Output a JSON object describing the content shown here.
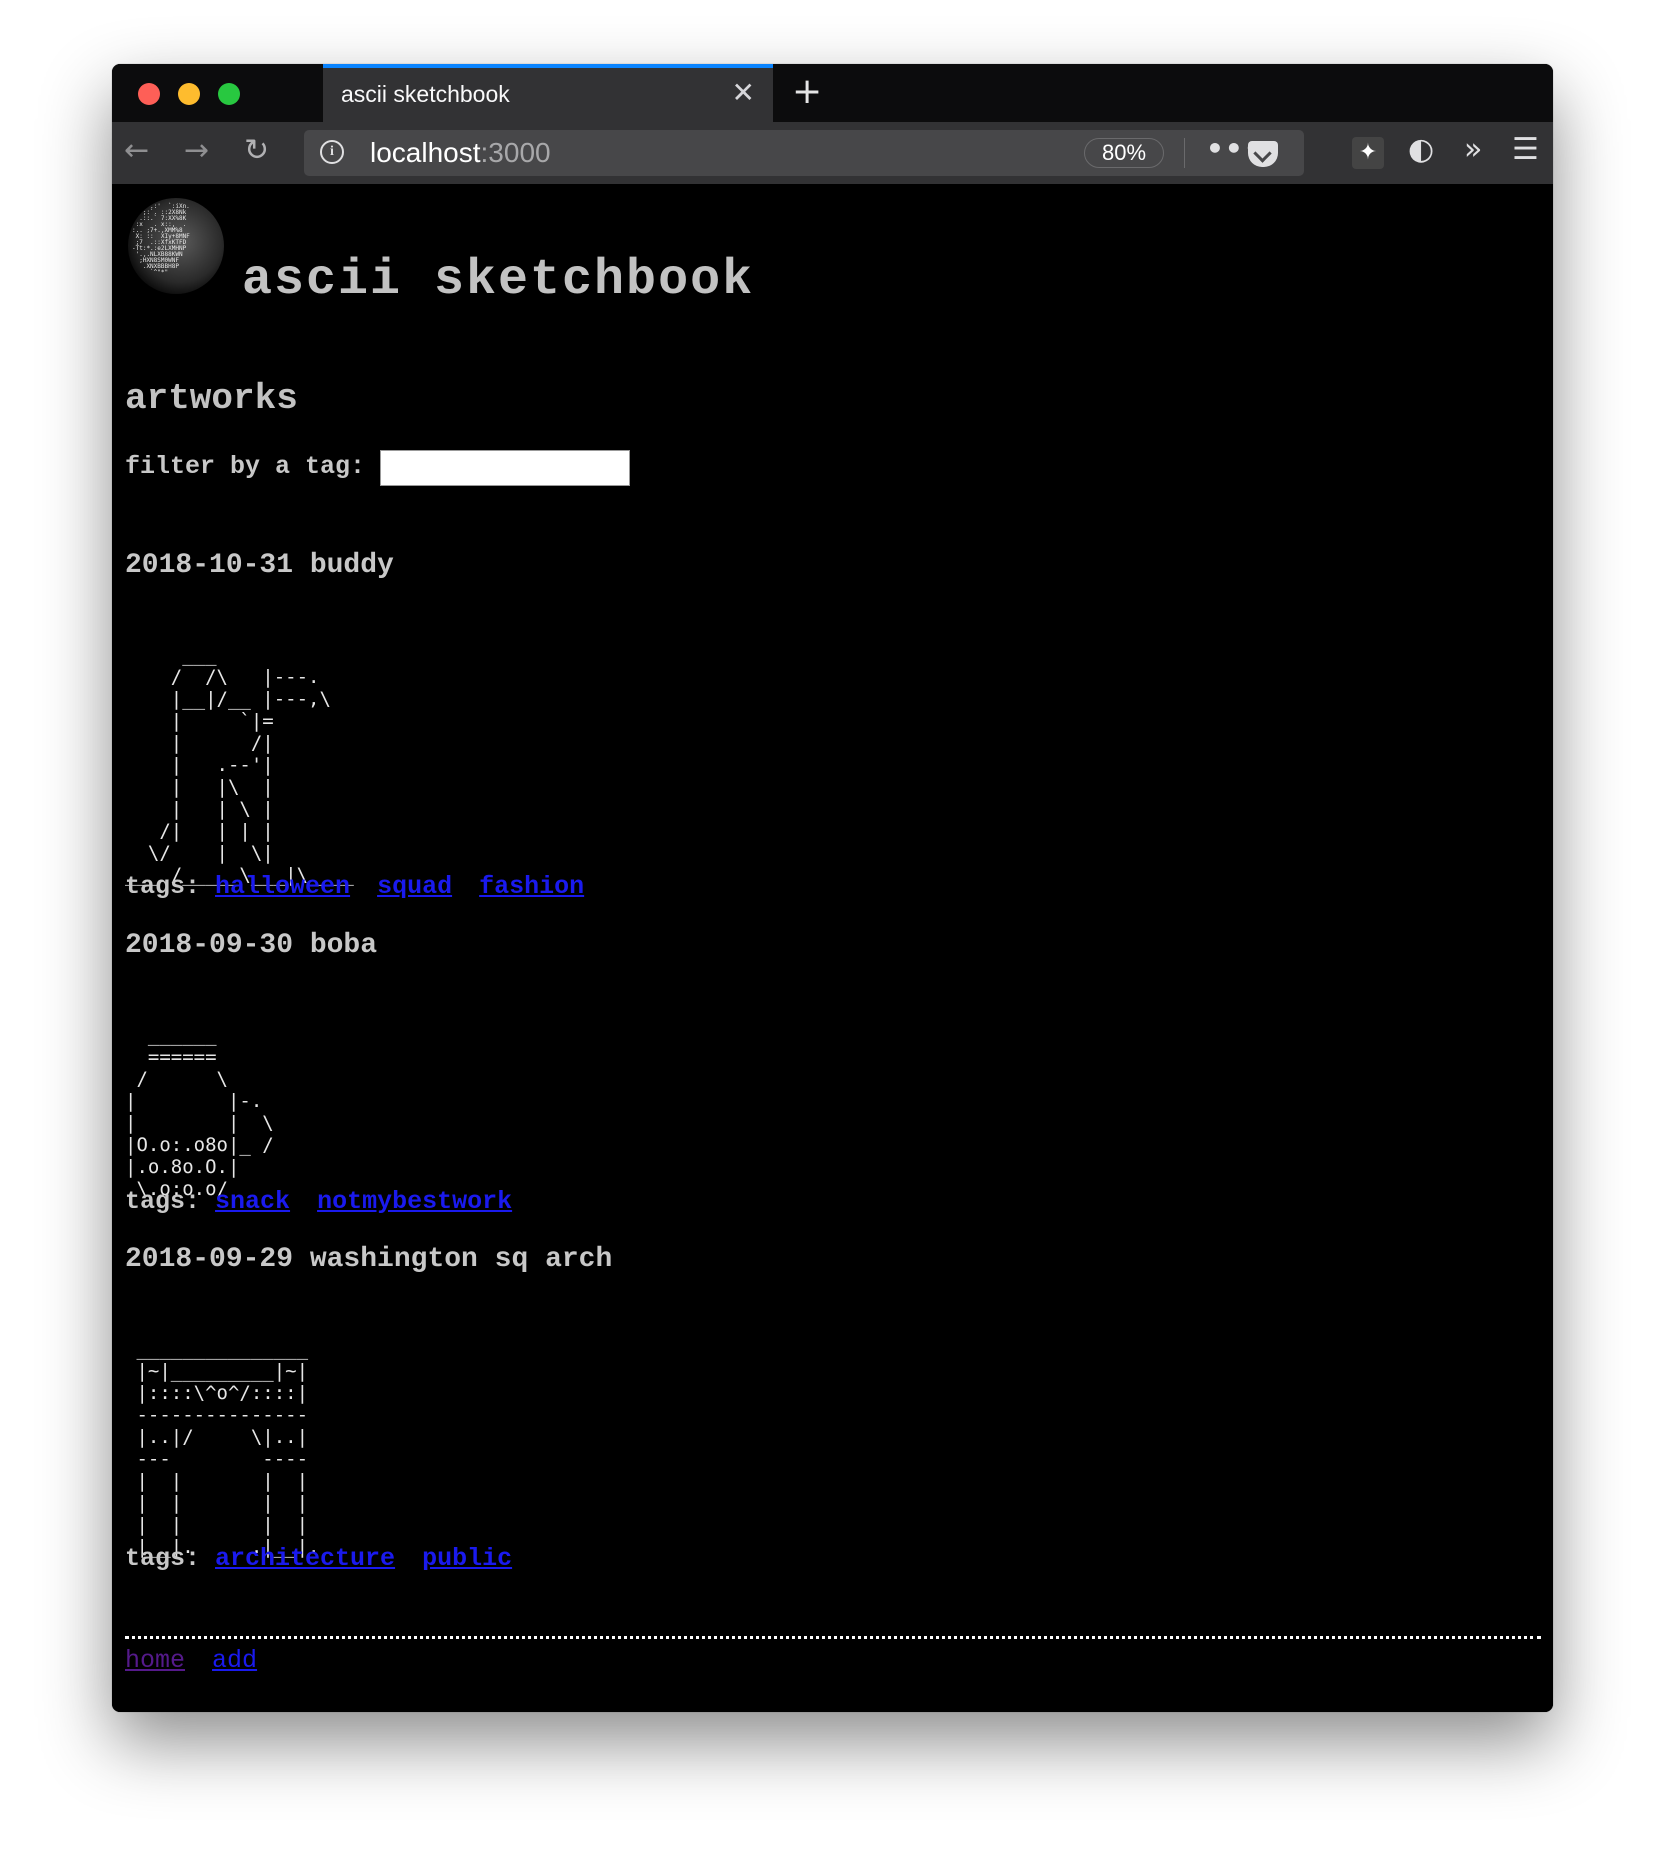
{
  "browser": {
    "tab_title": "ascii sketchbook",
    "tab_close": "✕",
    "new_tab": "+",
    "url_host": "localhost",
    "url_port": ":3000",
    "zoom": "80%",
    "more": "•••",
    "overflow": "»",
    "menu": "☰"
  },
  "site": {
    "title": "ascii sketchbook",
    "logo_ascii": "     .:'  `:iXn.\n   ;:`. ::2X8Nk\n  .::.` 7:XX%8K\n :x   . x::,  .\n:.. ;7+.,XMM%8\n X: ::  XIy+8MNF\n ;7  .::XfxKTFD\n-Tt:*.:e2LXMHNP\n '.,.NLXB88KWN\n  ;HXN8SM0WNF\n   .XNXBBBH8P\n     `^\"*\""
  },
  "section": {
    "heading": "artworks",
    "filter_label": "filter by a tag:",
    "filter_value": ""
  },
  "artworks": [
    {
      "title": "2018-10-31 buddy",
      "ascii": "     ___\n    /  /\\   |---.\n    |__|/__ |---,\\\n    |     `|=\n    |      /|\n    |   .--'|\n    |   |\\  |\n    |   | \\ |\n   /|   | | |\n  \\/    |  \\|\n___ /_____\\___|\\____",
      "tags_label": "tags:",
      "tags": [
        "halloween",
        "squad",
        "fashion"
      ]
    },
    {
      "title": "2018-09-30 boba",
      "ascii": "  ______\n  ======\n /      \\\n|        |-.\n|        |  \\\n|O.o:.o8o|_ /\n|.o.8o.O.|\n \\.o:o.o/",
      "tags_label": "tags:",
      "tags": [
        "snack",
        "notmybestwork"
      ]
    },
    {
      "title": "2018-09-29 washington sq arch",
      "ascii": " _______________\n |~|_________|~|\n |::::\\^o^/::::|\n ---------------\n |..|/     \\|..|\n ---        ----\n |  |       |  |\n |  |       |  |\n |  |       |  |\n.|__|.     .|__|.",
      "tags_label": "tags:",
      "tags": [
        "architecture",
        "public"
      ]
    }
  ],
  "footer": {
    "home": "home",
    "add": "add"
  }
}
